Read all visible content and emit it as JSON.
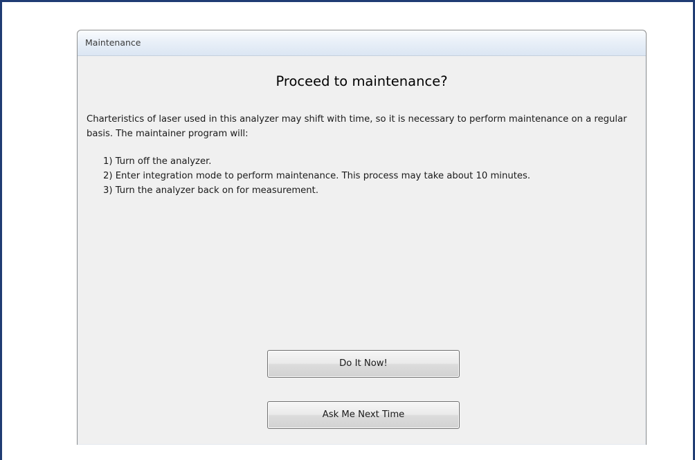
{
  "window": {
    "title": "Maintenance"
  },
  "dialog": {
    "heading": "Proceed to maintenance?",
    "intro": "Charteristics of laser used in this analyzer may shift with time, so it is necessary to perform maintenance on a regular basis. The maintainer program will:",
    "steps": [
      "1) Turn off the analyzer.",
      "2) Enter integration mode to perform maintenance. This process may take about 10 minutes.",
      "3) Turn the analyzer back on for measurement."
    ]
  },
  "buttons": {
    "do_it_now": "Do It Now!",
    "ask_next_time": "Ask Me Next Time"
  },
  "colors": {
    "frame_border": "#1f3b73",
    "dialog_background": "#f0f0f0",
    "title_bar": "#dbe6f3"
  }
}
